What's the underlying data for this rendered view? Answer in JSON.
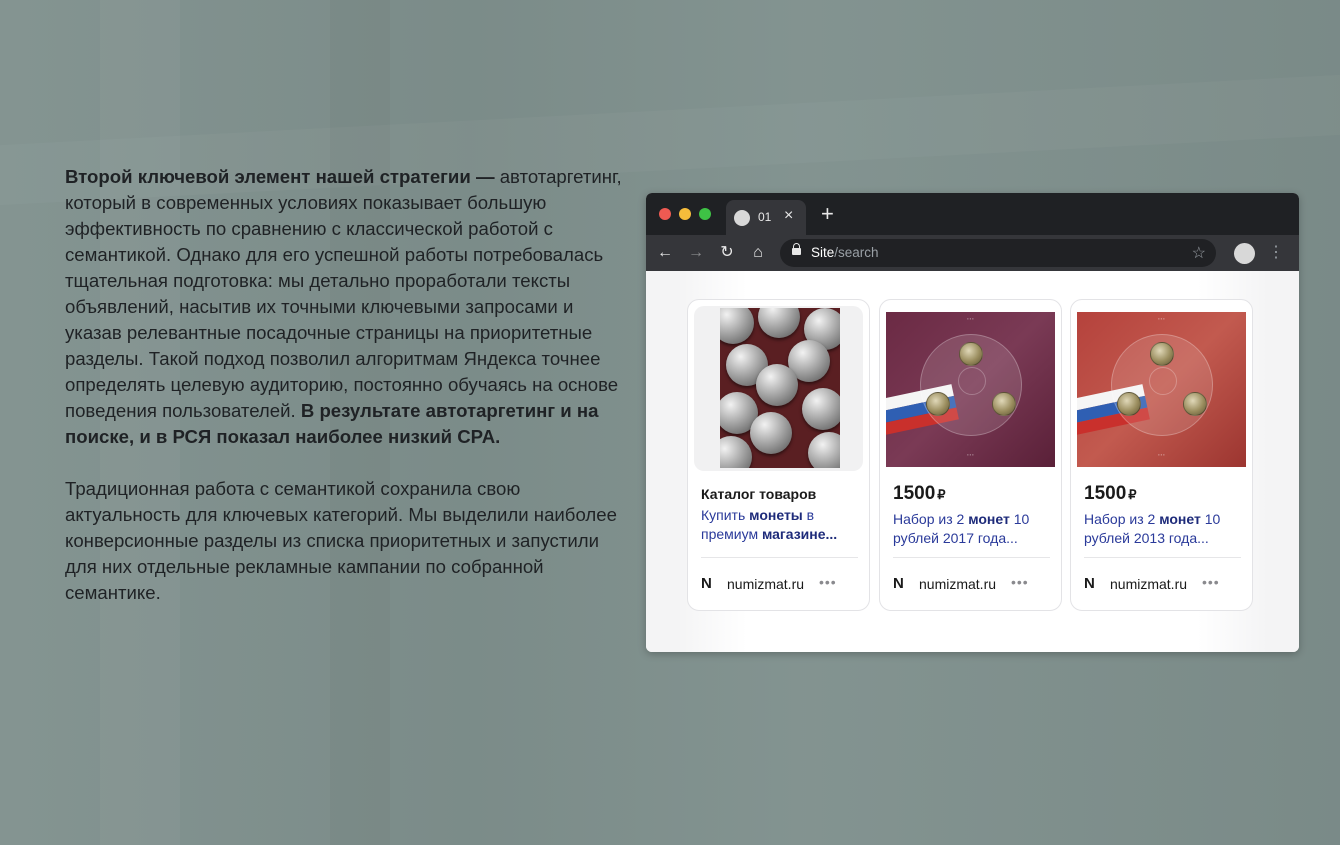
{
  "article": {
    "p1_bold": "Второй ключевой элемент нашей стратегии —",
    "p1_text": "автотаргетинг, который в современных условиях показывает большую эффективность по сравнению с классической работой с семантикой. Однако для его успешной работы потребовалась тщательная подготовка: мы детально проработали тексты объявлений, насытив их точными ключевыми запросами и указав релевантные посадочные страницы на приоритетные разделы. Такой подход позволил алгоритмам Яндекса точнее определять целевую аудиторию, постоянно обучаясь на основе поведения пользователей.",
    "p1_bold_end": "В результате автотаргетинг и на поиске, и в РСЯ показал наиболее низкий CPA.",
    "p2_text": "Традиционная работа с семантикой сохранила свою актуальность для ключевых категорий. Мы выделили наиболее конверсионные разделы из списка приоритетных и запустили для них отдельные рекламные кампании по собранной семантике."
  },
  "browser": {
    "tab_title": "01",
    "tab_close": "×",
    "new_tab": "+",
    "url_host": "Site",
    "url_path": "/search",
    "back": "←",
    "forward": "→",
    "reload": "↻",
    "home": "⌂",
    "star": "☆",
    "menu": "⋮"
  },
  "cards": [
    {
      "title": "Каталог товаров",
      "link_pre": "Купить ",
      "link_kw": "монеты",
      "link_mid": " в премиум ",
      "link_kw2": "магазине...",
      "domain": "numizmat.ru",
      "brand_icon": "N",
      "more": "•••"
    },
    {
      "price": "1500",
      "currency": "₽",
      "link_pre": "Набор из 2 ",
      "link_kw": "монет",
      "link_post": " 10 рублей 2017 года...",
      "domain": "numizmat.ru",
      "brand_icon": "N",
      "more": "•••"
    },
    {
      "price": "1500",
      "currency": "₽",
      "link_pre": "Набор из 2 ",
      "link_kw": "монет",
      "link_post": " 10 рублей 2013 года...",
      "domain": "numizmat.ru",
      "brand_icon": "N",
      "more": "•••"
    }
  ],
  "colors": {
    "page_bg": "#7f908d",
    "titlebar": "#1f2124",
    "toolbar": "#35363a",
    "link": "#2a3a9a"
  },
  "icons": [
    "back-arrow-icon",
    "forward-arrow-icon",
    "reload-icon",
    "home-icon",
    "lock-icon",
    "star-icon",
    "menu-icon",
    "close-icon",
    "plus-icon",
    "more-dots-icon"
  ]
}
